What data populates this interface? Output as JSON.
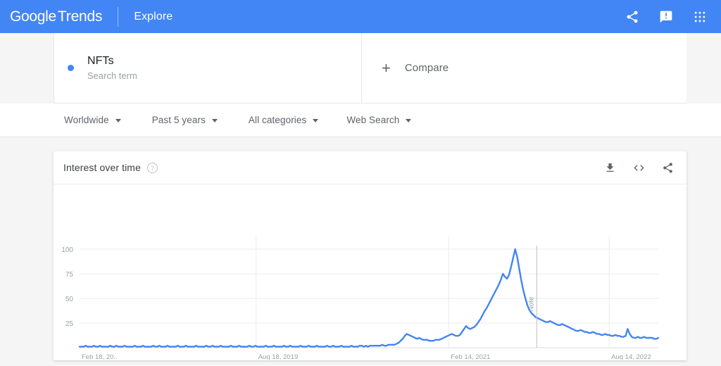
{
  "appbar": {
    "brand_google": "Google",
    "brand_trends": "Trends",
    "explore": "Explore",
    "icons": [
      {
        "name": "share-icon",
        "label": "Share"
      },
      {
        "name": "feedback-icon",
        "label": "Send feedback"
      },
      {
        "name": "apps-grid-icon",
        "label": "Google apps"
      }
    ],
    "bg_color": "#4285f4"
  },
  "query": {
    "term": "NFTs",
    "type_label": "Search term",
    "dot_color": "#4285f4",
    "compare_label": "Compare",
    "compare_plus": "+"
  },
  "filters": [
    {
      "name": "location",
      "label": "Worldwide"
    },
    {
      "name": "time-range",
      "label": "Past 5 years"
    },
    {
      "name": "category",
      "label": "All categories"
    },
    {
      "name": "search-type",
      "label": "Web Search"
    }
  ],
  "card": {
    "title": "Interest over time",
    "help_glyph": "?",
    "actions": [
      {
        "name": "download-icon",
        "label": "Download CSV"
      },
      {
        "name": "embed-icon",
        "label": "Embed"
      },
      {
        "name": "share-icon",
        "label": "Share"
      }
    ]
  },
  "chart_data": {
    "type": "line",
    "title": "Interest over time",
    "xlabel": "",
    "ylabel": "",
    "ylim": [
      0,
      100
    ],
    "yticks": [
      100,
      75,
      50,
      25
    ],
    "xticks": [
      "Feb 18, 20..",
      "Aug 18, 2019",
      "Feb 14, 2021",
      "Aug 14, 2022"
    ],
    "xtick_positions": [
      0.0,
      0.305,
      0.638,
      0.915
    ],
    "grid": true,
    "legend_position": "none",
    "line_color": "#4285f4",
    "annotations": [
      {
        "name": "note-marker",
        "label": "Note",
        "x_fraction": 0.79,
        "color": "#9aa0a6"
      }
    ],
    "series": [
      {
        "name": "NFTs",
        "color": "#4285f4",
        "values": [
          1,
          1,
          1,
          2,
          1,
          1,
          1,
          2,
          1,
          1,
          2,
          1,
          1,
          1,
          1,
          2,
          1,
          1,
          2,
          1,
          1,
          1,
          2,
          1,
          1,
          1,
          1,
          2,
          1,
          1,
          1,
          2,
          1,
          1,
          1,
          1,
          2,
          1,
          1,
          2,
          1,
          1,
          1,
          2,
          1,
          1,
          1,
          1,
          2,
          1,
          1,
          1,
          2,
          1,
          1,
          1,
          1,
          2,
          1,
          1,
          1,
          1,
          2,
          1,
          1,
          2,
          1,
          1,
          1,
          2,
          1,
          1,
          1,
          1,
          2,
          1,
          1,
          1,
          2,
          1,
          1,
          1,
          1,
          2,
          1,
          1,
          2,
          1,
          1,
          1,
          1,
          2,
          1,
          1,
          1,
          2,
          1,
          1,
          1,
          1,
          2,
          1,
          1,
          2,
          1,
          1,
          1,
          1,
          2,
          1,
          1,
          1,
          2,
          1,
          1,
          1,
          2,
          1,
          1,
          1,
          1,
          2,
          1,
          1,
          2,
          1,
          1,
          1,
          2,
          1,
          1,
          1,
          1,
          2,
          1,
          1,
          1,
          2,
          2,
          1,
          2,
          1,
          2,
          2,
          2,
          2,
          2,
          2,
          3,
          2,
          2,
          3,
          3,
          3,
          3,
          4,
          5,
          7,
          9,
          12,
          14,
          13,
          12,
          11,
          10,
          9,
          10,
          9,
          8,
          8,
          8,
          7,
          7,
          7,
          8,
          8,
          8,
          9,
          10,
          11,
          12,
          13,
          14,
          13,
          12,
          12,
          13,
          16,
          19,
          22,
          20,
          19,
          20,
          21,
          23,
          26,
          29,
          33,
          37,
          40,
          44,
          48,
          52,
          56,
          60,
          64,
          69,
          75,
          72,
          70,
          74,
          82,
          91,
          100,
          92,
          80,
          68,
          58,
          50,
          43,
          38,
          35,
          33,
          31,
          30,
          29,
          28,
          27,
          26,
          26,
          27,
          26,
          25,
          24,
          23,
          23,
          24,
          23,
          22,
          21,
          20,
          19,
          18,
          17,
          17,
          18,
          17,
          16,
          16,
          15,
          15,
          16,
          15,
          14,
          14,
          13,
          13,
          14,
          13,
          13,
          12,
          12,
          13,
          12,
          12,
          11,
          11,
          12,
          19,
          14,
          11,
          10,
          10,
          11,
          10,
          10,
          11,
          10,
          10,
          10,
          10,
          9,
          9,
          10
        ]
      }
    ]
  }
}
